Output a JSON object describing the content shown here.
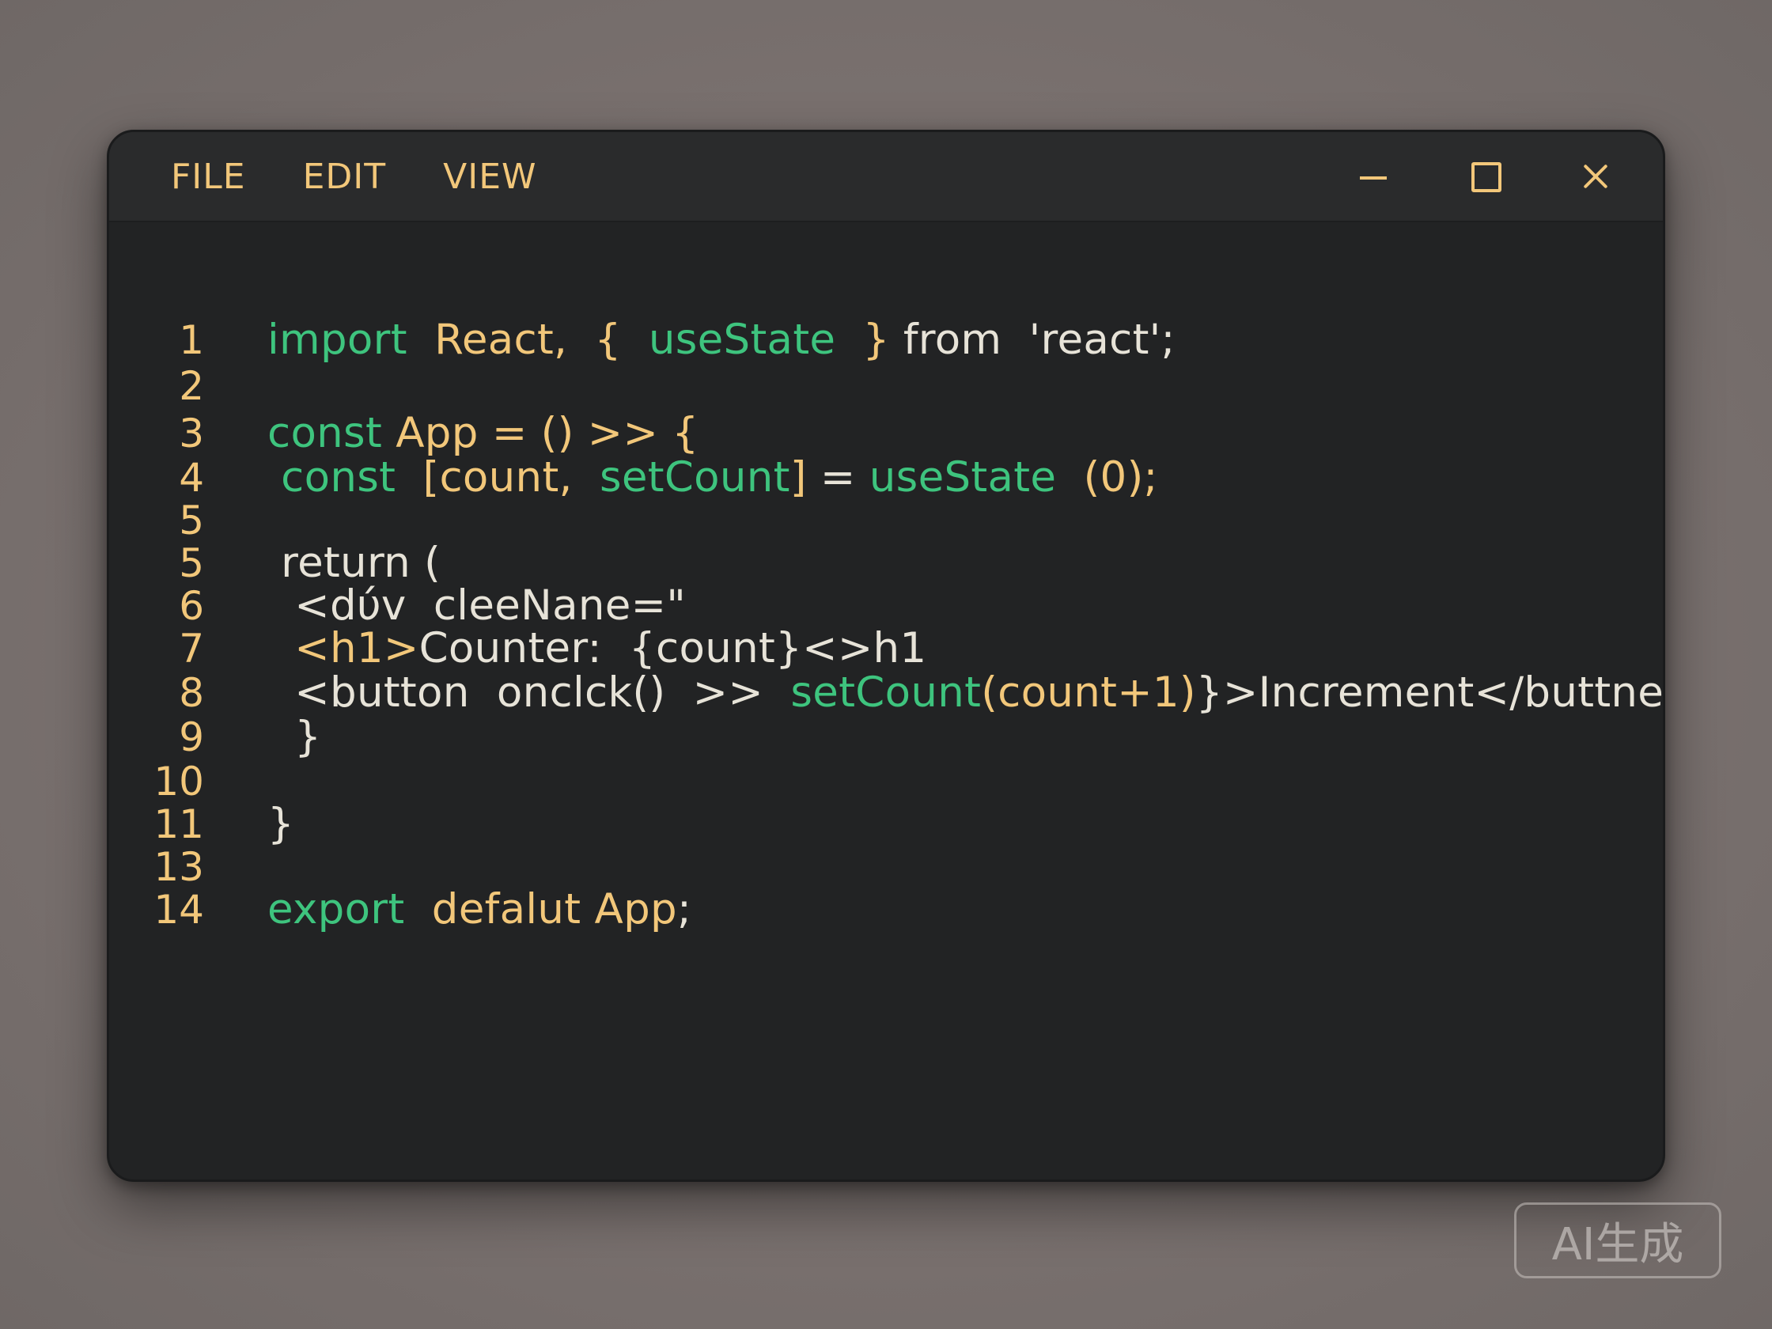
{
  "menu": {
    "file": "FILE",
    "edit": "EDIT",
    "view": "VIEW"
  },
  "window_controls": [
    "minimize-icon",
    "maximize-icon",
    "close-icon"
  ],
  "colors": {
    "keyword": "#3ec47e",
    "identifier": "#f2c77a",
    "plain": "#e7e3d8",
    "background": "#222324",
    "titlebar": "#2a2b2c"
  },
  "editor": {
    "lines": [
      {
        "num": "1",
        "tokens": [
          {
            "t": "import",
            "c": "g"
          },
          {
            "t": "  ",
            "c": "w"
          },
          {
            "t": "React,",
            "c": "y"
          },
          {
            "t": "  ",
            "c": "w"
          },
          {
            "t": "{",
            "c": "y"
          },
          {
            "t": "  ",
            "c": "w"
          },
          {
            "t": "useState",
            "c": "g"
          },
          {
            "t": "  ",
            "c": "w"
          },
          {
            "t": "}",
            "c": "y"
          },
          {
            "t": " from  'react';",
            "c": "w"
          }
        ]
      },
      {
        "num": "2",
        "tokens": []
      },
      {
        "num": "3",
        "tokens": [
          {
            "t": "const",
            "c": "g"
          },
          {
            "t": " ",
            "c": "w"
          },
          {
            "t": "App",
            "c": "y"
          },
          {
            "t": " = () >> {",
            "c": "y"
          }
        ]
      },
      {
        "num": "4",
        "tokens": [
          {
            "t": " ",
            "c": "w"
          },
          {
            "t": "const",
            "c": "g"
          },
          {
            "t": "  ",
            "c": "w"
          },
          {
            "t": "[count,",
            "c": "y"
          },
          {
            "t": "  ",
            "c": "w"
          },
          {
            "t": "setCount",
            "c": "g"
          },
          {
            "t": "]",
            "c": "y"
          },
          {
            "t": " = ",
            "c": "w"
          },
          {
            "t": "useState",
            "c": "g"
          },
          {
            "t": "  ",
            "c": "w"
          },
          {
            "t": "(0);",
            "c": "y"
          }
        ]
      },
      {
        "num": "5",
        "tokens": []
      },
      {
        "num": "5",
        "tokens": [
          {
            "t": " return (",
            "c": "w"
          }
        ]
      },
      {
        "num": "6",
        "tokens": [
          {
            "t": "  <dύv  cleeNane=\"",
            "c": "w"
          }
        ]
      },
      {
        "num": "7",
        "tokens": [
          {
            "t": "  <h1>",
            "c": "y"
          },
          {
            "t": "Counter:  {count}<>h1",
            "c": "w"
          }
        ]
      },
      {
        "num": "8",
        "tokens": [
          {
            "t": "  <button  onclck()  >>  ",
            "c": "w"
          },
          {
            "t": "setCount",
            "c": "g"
          },
          {
            "t": "(count+1)",
            "c": "y"
          },
          {
            "t": "}>Increment</buttner",
            "c": "w"
          }
        ]
      },
      {
        "num": "9",
        "tokens": [
          {
            "t": "  }",
            "c": "w"
          }
        ]
      },
      {
        "num": "10",
        "tokens": []
      },
      {
        "num": "11",
        "tokens": [
          {
            "t": "}",
            "c": "w"
          }
        ]
      },
      {
        "num": "13",
        "tokens": []
      },
      {
        "num": "14",
        "tokens": [
          {
            "t": "export",
            "c": "g"
          },
          {
            "t": "  ",
            "c": "w"
          },
          {
            "t": "defalut",
            "c": "y"
          },
          {
            "t": " ",
            "c": "w"
          },
          {
            "t": "App",
            "c": "y"
          },
          {
            "t": ";",
            "c": "w"
          }
        ]
      }
    ]
  },
  "watermark": "AI生成"
}
